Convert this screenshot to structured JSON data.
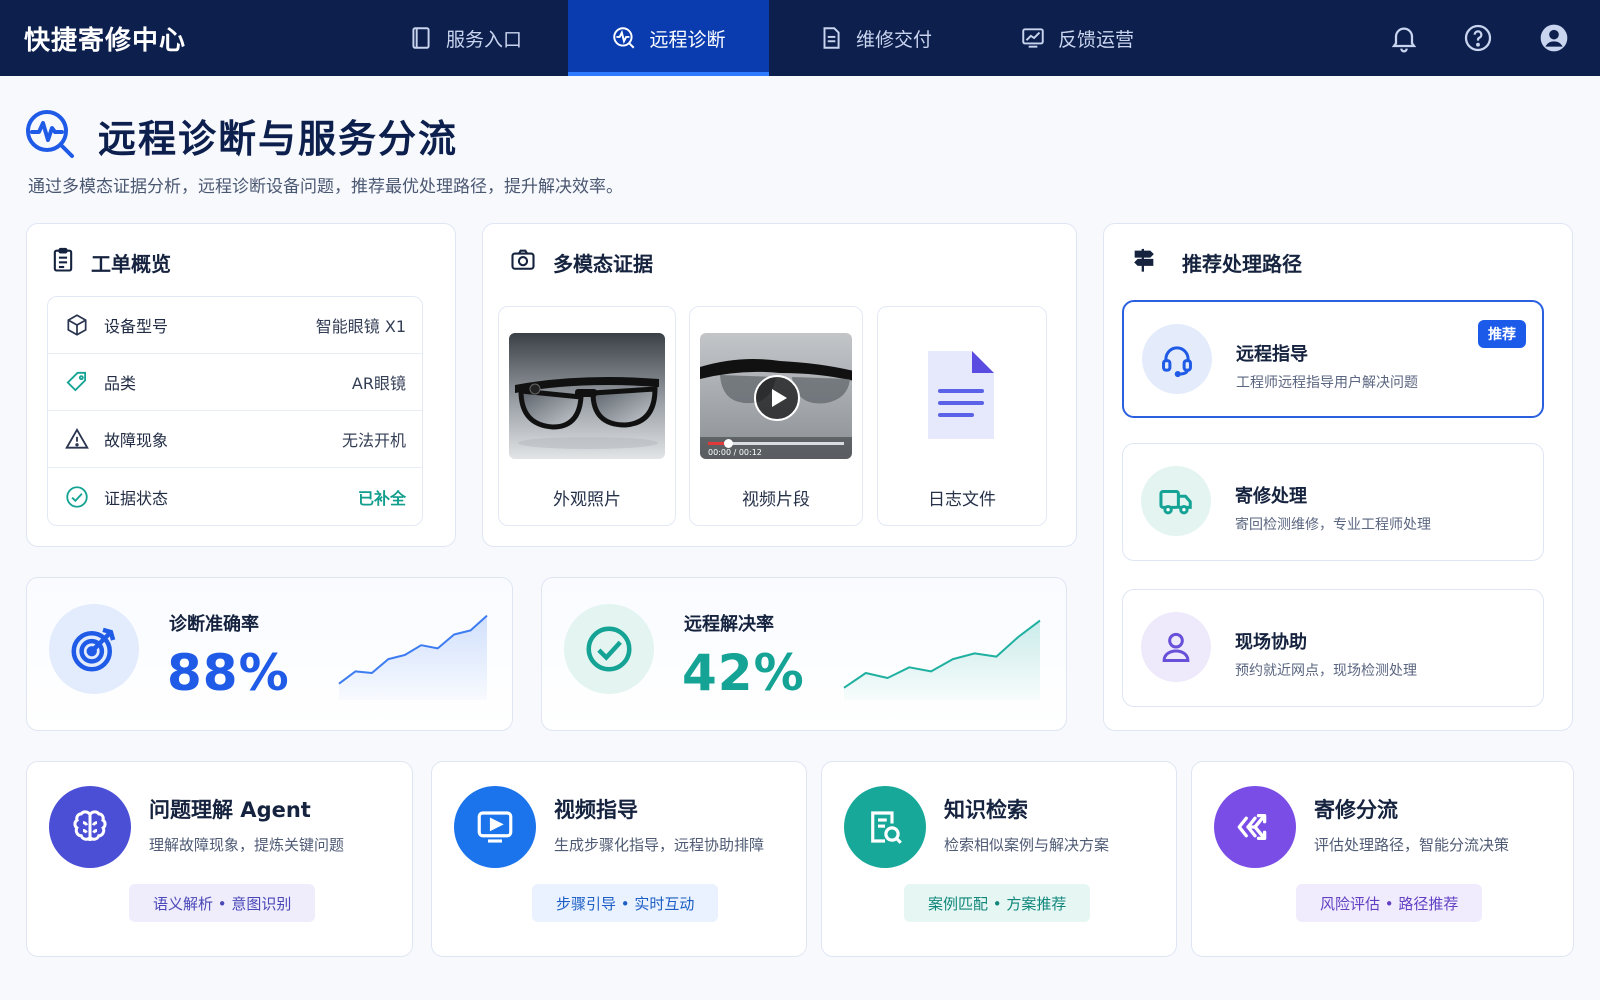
{
  "app": {
    "brand": "快捷寄修中心"
  },
  "nav": {
    "tabs": [
      {
        "label": "服务入口",
        "icon": "book-icon"
      },
      {
        "label": "远程诊断",
        "icon": "diagnosis-icon"
      },
      {
        "label": "维修交付",
        "icon": "document-icon"
      },
      {
        "label": "反馈运营",
        "icon": "chart-icon"
      }
    ],
    "active_index": 1,
    "right_icons": [
      "bell-icon",
      "help-icon",
      "user-icon"
    ]
  },
  "header": {
    "title": "远程诊断与服务分流",
    "subtitle": "通过多模态证据分析，远程诊断设备问题，推荐最优处理路径，提升解决效率。"
  },
  "overview": {
    "title": "工单概览",
    "rows": [
      {
        "label": "设备型号",
        "value": "智能眼镜 X1",
        "icon": "cube-icon"
      },
      {
        "label": "品类",
        "value": "AR眼镜",
        "icon": "tag-icon"
      },
      {
        "label": "故障现象",
        "value": "无法开机",
        "icon": "warning-icon"
      },
      {
        "label": "证据状态",
        "value": "已补全",
        "icon": "check-circle-icon"
      }
    ]
  },
  "evidence": {
    "title": "多模态证据",
    "items": [
      {
        "label": "外观照片",
        "type": "photo"
      },
      {
        "label": "视频片段",
        "type": "video",
        "timecode": "00:00 / 00:12",
        "progress": 0.15
      },
      {
        "label": "日志文件",
        "type": "file"
      }
    ]
  },
  "routes": {
    "title": "推荐处理路径",
    "items": [
      {
        "title": "远程指导",
        "desc": "工程师远程指导用户解决问题",
        "badge": "推荐",
        "icon": "headset-icon"
      },
      {
        "title": "寄修处理",
        "desc": "寄回检测维修，专业工程师处理",
        "icon": "truck-icon"
      },
      {
        "title": "现场协助",
        "desc": "预约就近网点，现场检测处理",
        "icon": "person-icon"
      }
    ]
  },
  "metrics": [
    {
      "label": "诊断准确率",
      "value": "88%",
      "color": "#1f5be6",
      "trend": [
        0.15,
        0.3,
        0.28,
        0.45,
        0.5,
        0.62,
        0.58,
        0.75,
        0.8,
        0.98
      ]
    },
    {
      "label": "远程解决率",
      "value": "42%",
      "color": "#14a394",
      "trend": [
        0.1,
        0.28,
        0.22,
        0.35,
        0.3,
        0.45,
        0.52,
        0.48,
        0.72,
        0.92
      ]
    }
  ],
  "agents": [
    {
      "title": "问题理解 Agent",
      "desc": "理解故障现象，提炼关键问题",
      "tags": "语义解析 • 意图识别",
      "icon": "brain-icon",
      "color": "#4a4fd6",
      "tag_bg": "#efedfc",
      "tag_color": "#4a47b8"
    },
    {
      "title": "视频指导",
      "desc": "生成步骤化指导，远程协助排障",
      "tags": "步骤引导 • 实时互动",
      "icon": "video-play-icon",
      "color": "#1c74ec",
      "tag_bg": "#e9f2fe",
      "tag_color": "#1d5fc6"
    },
    {
      "title": "知识检索",
      "desc": "检索相似案例与解决方案",
      "tags": "案例匹配 • 方案推荐",
      "icon": "doc-search-icon",
      "color": "#17a89a",
      "tag_bg": "#e5f6f3",
      "tag_color": "#11877b"
    },
    {
      "title": "寄修分流",
      "desc": "评估处理路径，智能分流决策",
      "tags": "风险评估 • 路径推荐",
      "icon": "split-arrows-icon",
      "color": "#7a4ee6",
      "tag_bg": "#f1ecfd",
      "tag_color": "#6140c4"
    }
  ]
}
